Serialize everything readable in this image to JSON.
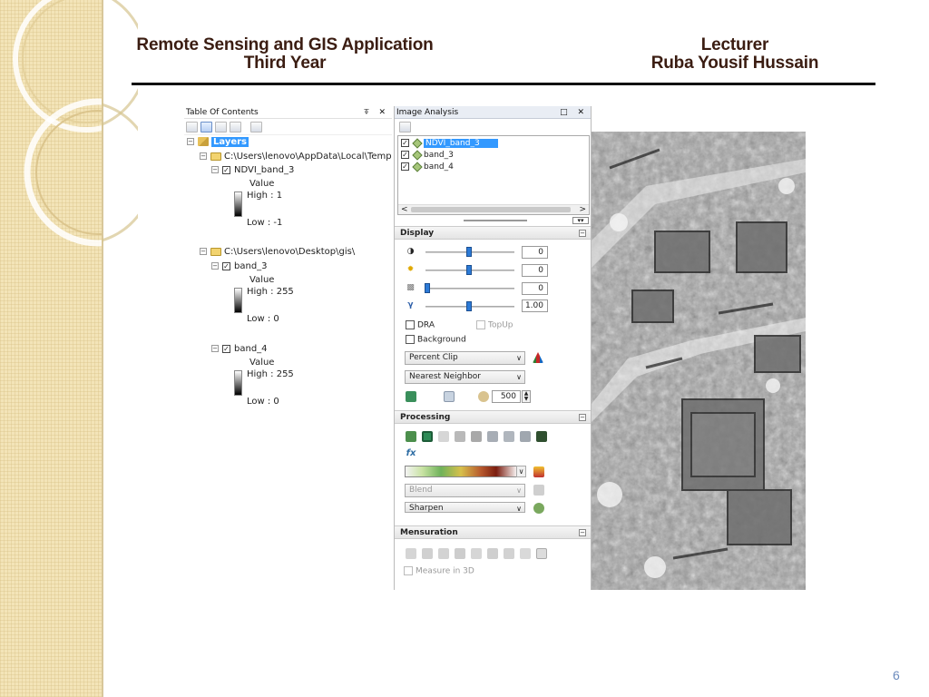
{
  "slide": {
    "title_line1": "Remote Sensing and GIS Application",
    "title_line2": "Third Year",
    "lecturer_label": "Lecturer",
    "lecturer_name": "Ruba Yousif Hussain",
    "page_number": "6"
  },
  "toc": {
    "title": "Table Of Contents",
    "title_buttons": "⍕ ✕",
    "root": "Layers",
    "groups": [
      {
        "path": "C:\\Users\\lenovo\\AppData\\Local\\Temp",
        "layers": [
          {
            "name": "NDVI_band_3",
            "value_label": "Value",
            "high": "High : 1",
            "low": "Low : -1"
          }
        ]
      },
      {
        "path": "C:\\Users\\lenovo\\Desktop\\gis\\",
        "layers": [
          {
            "name": "band_3",
            "value_label": "Value",
            "high": "High : 255",
            "low": "Low : 0"
          },
          {
            "name": "band_4",
            "value_label": "Value",
            "high": "High : 255",
            "low": "Low : 0"
          }
        ]
      }
    ]
  },
  "image_analysis": {
    "title": "Image Analysis",
    "title_buttons": "□ ✕",
    "layers": [
      "NDVI_band_3",
      "band_3",
      "band_4"
    ],
    "selected_layer": "NDVI_band_3",
    "display": {
      "header": "Display",
      "contrast": "0",
      "brightness": "0",
      "transparency": "0",
      "gamma": "1.00",
      "gamma_symbol": "γ",
      "dra_label": "DRA",
      "topup_label": "TopUp",
      "background_label": "Background",
      "stretch": "Percent Clip",
      "resampling": "Nearest Neighbor",
      "zoom": "500"
    },
    "processing": {
      "header": "Processing",
      "blend": "Blend",
      "sharpen": "Sharpen"
    },
    "mensuration": {
      "header": "Mensuration",
      "measure3d": "Measure in 3D"
    }
  },
  "colors": {
    "title_text": "#3b1d12",
    "selection": "#3399ff",
    "page_number": "#6b8bbd",
    "strip": "#f3e4b8"
  }
}
